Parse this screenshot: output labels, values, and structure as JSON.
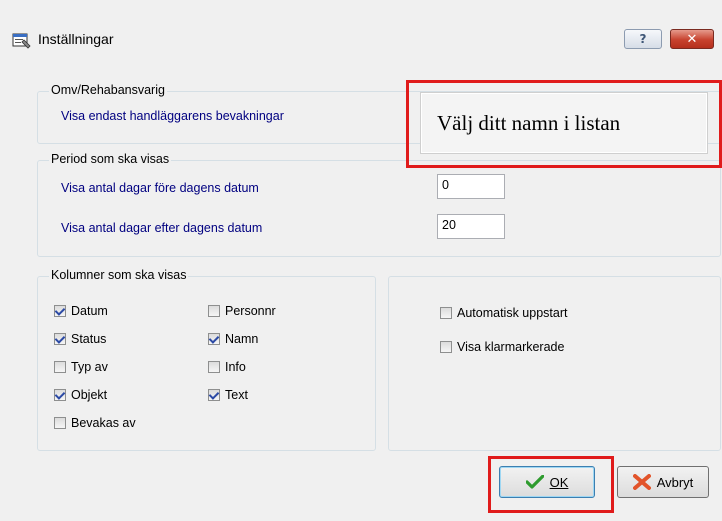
{
  "window": {
    "title": "Inställningar",
    "help_label": "?",
    "close_label": "✕"
  },
  "groups": {
    "rehab": {
      "legend": "Omv/Rehabansvarig",
      "label": "Visa endast handläggarens bevakningar"
    },
    "period": {
      "legend": "Period som ska visas",
      "before_label": "Visa antal dagar före dagens datum",
      "before_value": "0",
      "after_label": "Visa antal dagar efter dagens datum",
      "after_value": "20"
    },
    "columns": {
      "legend": "Kolumner som ska visas",
      "items": [
        {
          "label": "Datum",
          "checked": true
        },
        {
          "label": "Status",
          "checked": true
        },
        {
          "label": "Typ av",
          "checked": false
        },
        {
          "label": "Objekt",
          "checked": true
        },
        {
          "label": "Bevakas av",
          "checked": false
        },
        {
          "label": "Personnr",
          "checked": false
        },
        {
          "label": "Namn",
          "checked": true
        },
        {
          "label": "Info",
          "checked": false
        },
        {
          "label": "Text",
          "checked": true
        }
      ]
    },
    "options": {
      "items": [
        {
          "label": "Automatisk uppstart",
          "checked": false
        },
        {
          "label": "Visa klarmarkerade",
          "checked": false
        }
      ]
    }
  },
  "callout": "Välj ditt namn i listan",
  "buttons": {
    "ok": "OK",
    "cancel": "Avbryt"
  },
  "colors": {
    "highlight": "#e01b1b",
    "label_blue": "#000080"
  }
}
